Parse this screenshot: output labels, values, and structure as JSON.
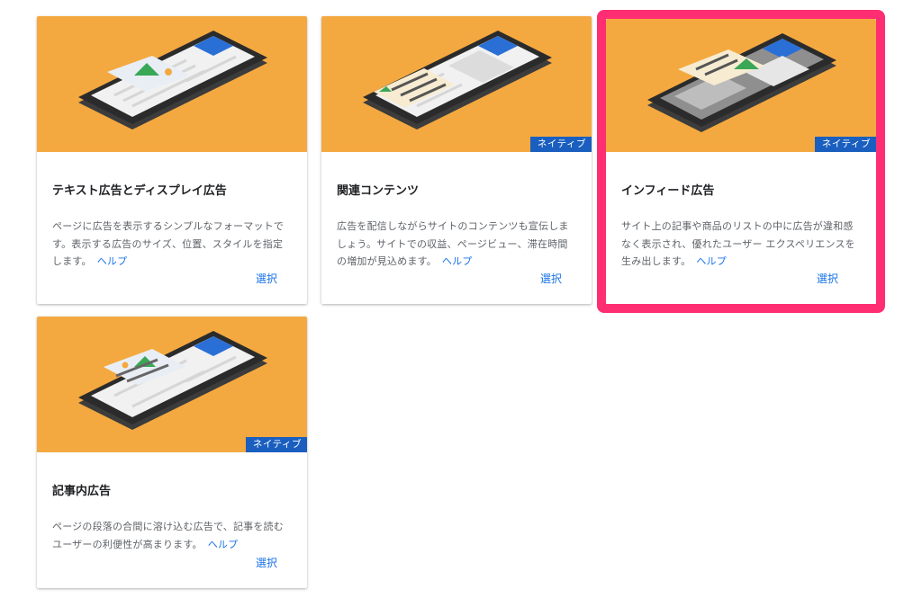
{
  "cards": [
    {
      "title": "テキスト広告とディスプレイ広告",
      "description": "ページに広告を表示するシンプルなフォーマットです。表示する広告のサイズ、位置、スタイルを指定します。",
      "help_label": "ヘルプ",
      "select_label": "選択",
      "badge": null
    },
    {
      "title": "関連コンテンツ",
      "description": "広告を配信しながらサイトのコンテンツも宣伝しましょう。サイトでの収益、ページビュー、滞在時間の増加が見込めます。",
      "help_label": "ヘルプ",
      "select_label": "選択",
      "badge": "ネイティブ"
    },
    {
      "title": "インフィード広告",
      "description": "サイト上の記事や商品のリストの中に広告が違和感なく表示され、優れたユーザー エクスペリエンスを生み出します。",
      "help_label": "ヘルプ",
      "select_label": "選択",
      "badge": "ネイティブ"
    },
    {
      "title": "記事内広告",
      "description": "ページの段落の合間に溶け込む広告で、記事を読むユーザーの利便性が高まります。",
      "help_label": "ヘルプ",
      "select_label": "選択",
      "badge": "ネイティブ"
    }
  ],
  "colors": {
    "hero_background": "#f4a940",
    "badge_background": "#1a5fbf",
    "link": "#1a73e8",
    "highlight_border": "#ff2e73"
  }
}
